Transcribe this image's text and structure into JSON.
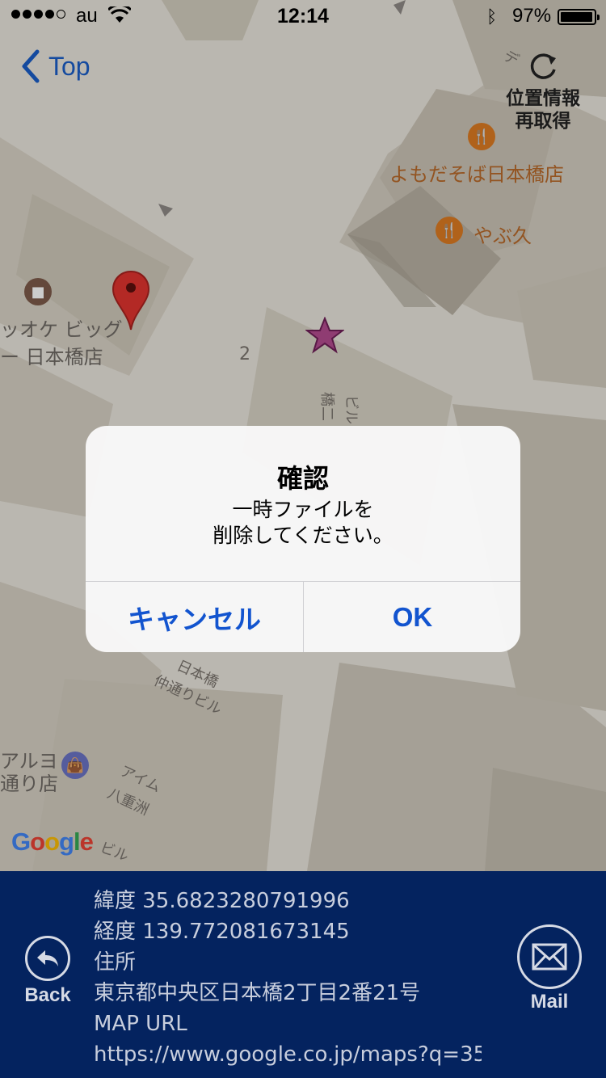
{
  "status_bar": {
    "carrier": "au",
    "time": "12:14",
    "battery": "97%",
    "battery_level": 0.97
  },
  "nav": {
    "back_label": "Top",
    "reacquire_line1": "位置情報",
    "reacquire_line2": "再取得"
  },
  "map": {
    "labels": {
      "restaurant1": "よもだそば日本橋店",
      "restaurant2": "やぶ久",
      "store_line1": "ッオケ ビッグ",
      "store_line2": "ー 日本橋店",
      "block_number": "2",
      "building1": "仲通りビル",
      "building1_top": "日本橋",
      "building2": "アイム",
      "building2b": "八重洲",
      "building3_line1": "アルヨ",
      "building3_line2": "通り店",
      "building4": "橋二",
      "building4b": "ビル",
      "building5": "デ",
      "building6": "ビル"
    },
    "google_logo": [
      "G",
      "o",
      "o",
      "g",
      "l",
      "e"
    ],
    "google_colors": [
      "#4285f4",
      "#ea4335",
      "#fbbc05",
      "#4285f4",
      "#34a853",
      "#ea4335"
    ]
  },
  "alert": {
    "title": "確認",
    "message": "一時ファイルを\n削除してください。",
    "cancel_label": "キャンセル",
    "ok_label": "OK"
  },
  "info": {
    "latitude": "緯度 35.6823280791996",
    "longitude": "経度 139.772081673145",
    "address_label": "住所",
    "address": "東京都中央区日本橋2丁目2番21号",
    "map_url_label": "MAP URL",
    "map_url": "https://www.google.co.jp/maps?q=35"
  },
  "bottom": {
    "back_label": "Back",
    "mail_label": "Mail"
  }
}
